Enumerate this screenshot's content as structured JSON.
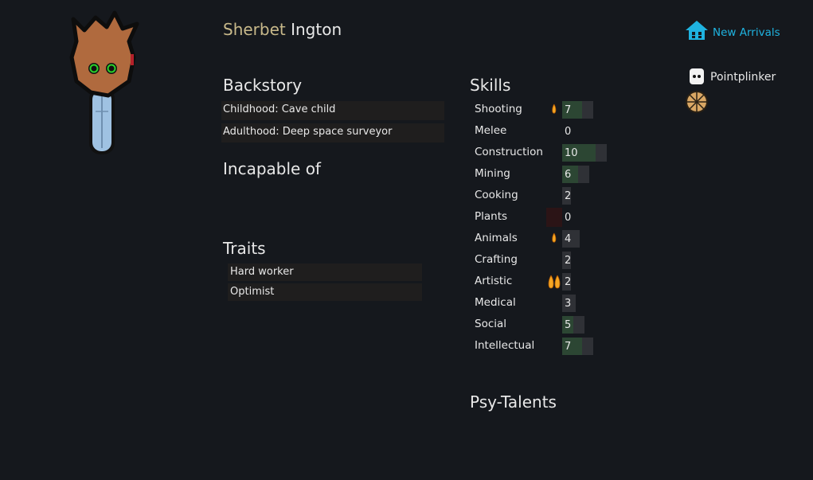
{
  "character": {
    "first_name": "Sherbet",
    "last_name": "Ington"
  },
  "backstory": {
    "title": "Backstory",
    "childhood": "Childhood: Cave child",
    "adulthood": "Adulthood: Deep space surveyor"
  },
  "incapable": {
    "title": "Incapable of"
  },
  "traits": {
    "title": "Traits",
    "items": [
      "Hard worker",
      "Optimist"
    ]
  },
  "skills": {
    "title": "Skills",
    "items": [
      {
        "name": "Shooting",
        "level": "7",
        "passion": "minor"
      },
      {
        "name": "Melee",
        "level": "0",
        "passion": "none"
      },
      {
        "name": "Construction",
        "level": "10",
        "passion": "none"
      },
      {
        "name": "Mining",
        "level": "6",
        "passion": "none"
      },
      {
        "name": "Cooking",
        "level": "2",
        "passion": "none"
      },
      {
        "name": "Plants",
        "level": "0",
        "passion": "none",
        "disabled": true
      },
      {
        "name": "Animals",
        "level": "4",
        "passion": "minor"
      },
      {
        "name": "Crafting",
        "level": "2",
        "passion": "none"
      },
      {
        "name": "Artistic",
        "level": "2",
        "passion": "major"
      },
      {
        "name": "Medical",
        "level": "3",
        "passion": "none"
      },
      {
        "name": "Social",
        "level": "5",
        "passion": "none"
      },
      {
        "name": "Intellectual",
        "level": "7",
        "passion": "none"
      }
    ]
  },
  "psy": {
    "title": "Psy-Talents"
  },
  "faction": {
    "label": "New Arrivals",
    "color": "#1fb3e0"
  },
  "ideoligion": {
    "label": "Pointplinker"
  }
}
